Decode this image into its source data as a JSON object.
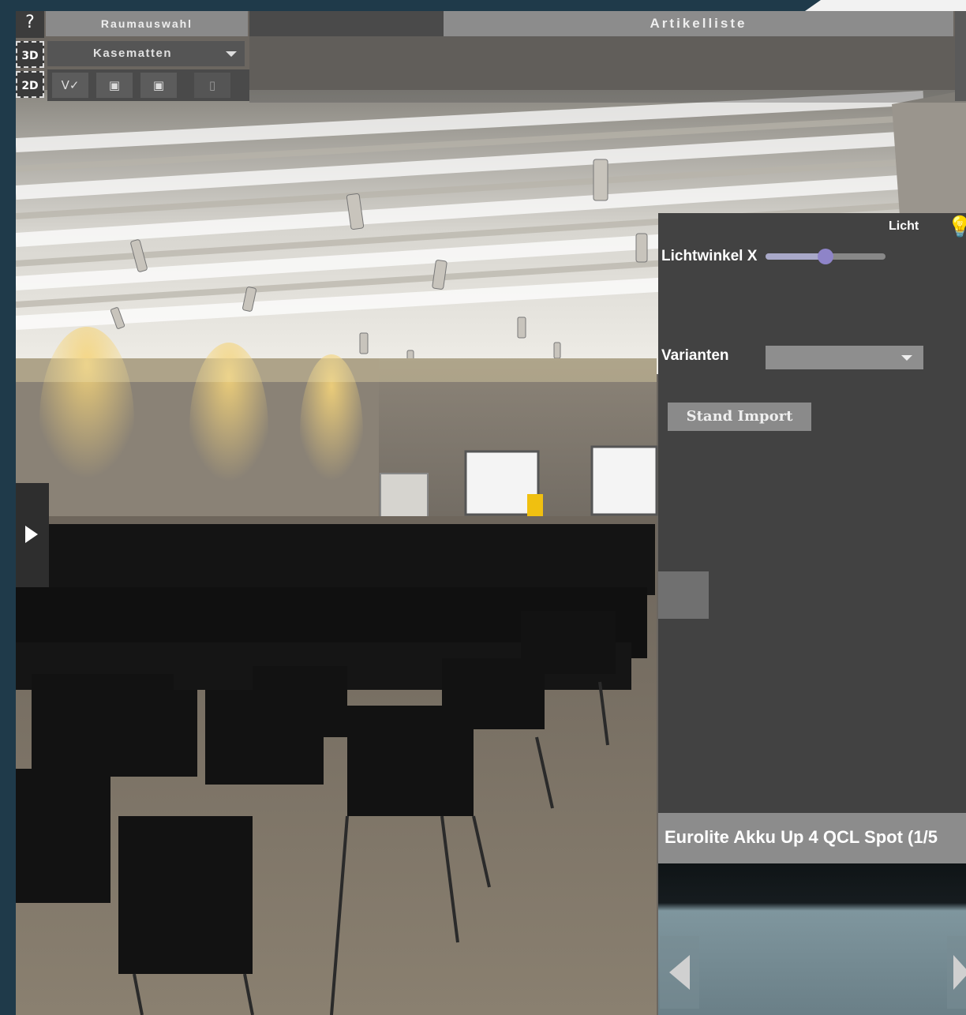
{
  "toolbar": {
    "help_label": "?",
    "mode_3d": "3D",
    "mode_2d": "2D",
    "room_tab": "Raumauswahl",
    "room_selected": "Kasematten",
    "article_tab": "Artikelliste",
    "icons": [
      "checkmark-icon",
      "image-icon",
      "folder-image-icon",
      "trash-icon"
    ],
    "icon_glyphs": [
      "V✓",
      "▣",
      "▣",
      "▯"
    ]
  },
  "panel": {
    "light_label": "Licht",
    "angle_label": "Lichtwinkel X",
    "angle_value": 0.5,
    "variants_label": "Varianten",
    "variants_selected": "",
    "stand_import_label": "Stand Import",
    "item_name": "Eurolite Akku Up 4 QCL Spot  (1/5"
  },
  "colors": {
    "background": "#1f3a4a",
    "panel": "#424242",
    "accent_knob": "#8e84c8"
  }
}
